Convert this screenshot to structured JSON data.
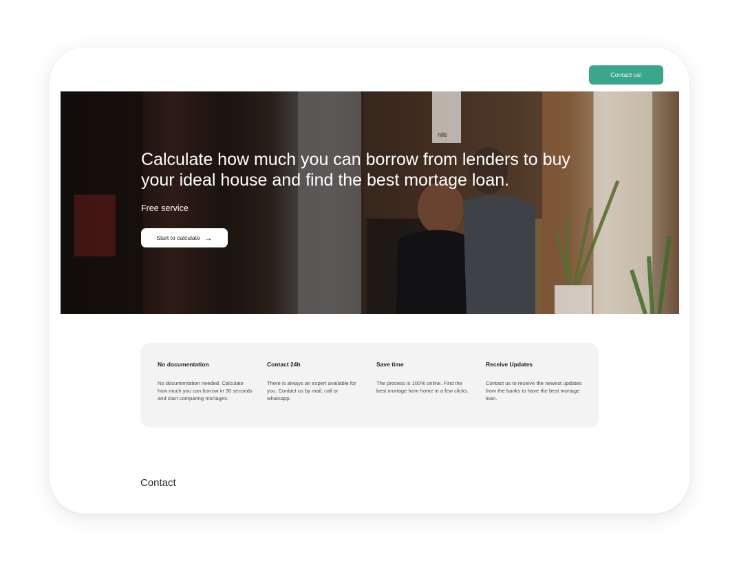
{
  "header": {
    "contact_button": "Contact us!"
  },
  "hero": {
    "title": "Calculate how much you can borrow from lenders to buy your ideal house and find the best mortage loan.",
    "subtitle": "Free service",
    "cta_label": "Start to calculate",
    "cta_icon": "arrow-right-icon",
    "sign_text": "nile"
  },
  "features": [
    {
      "title": "No documentation",
      "text": "No documentation needed. Calculate how much you can borrow in 30 seconds and start comparing mortages."
    },
    {
      "title": "Contact 24h",
      "text": "There is always an expert available for you. Contact us by mail, call or whatsapp."
    },
    {
      "title": "Save time",
      "text": "The process is 100% online. Find the best mortage from home in a few clicks."
    },
    {
      "title": "Receive Updates",
      "text": "Contact us to receive the newest updates from the banks to have the best mortage loan."
    }
  ],
  "contact_section": {
    "heading": "Contact"
  },
  "colors": {
    "accent": "#3aa68d",
    "card_bg": "#f3f3f3"
  }
}
